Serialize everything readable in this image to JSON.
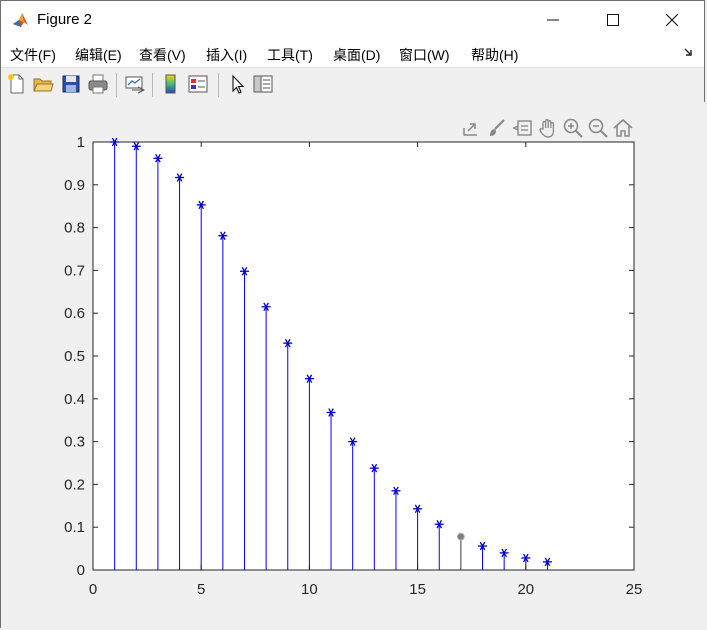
{
  "window": {
    "title": "Figure 2"
  },
  "menu": {
    "items": [
      "文件(F)",
      "编辑(E)",
      "查看(V)",
      "插入(I)",
      "工具(T)",
      "桌面(D)",
      "窗口(W)",
      "帮助(H)"
    ],
    "overflow_icon": "corner-arrow-icon"
  },
  "toolbar": {
    "buttons": [
      "new-figure-icon",
      "open-file-icon",
      "save-icon",
      "print-icon",
      "link-plot-icon",
      "insert-colorbar-icon",
      "insert-legend-icon",
      "edit-plot-icon",
      "open-property-inspector-icon"
    ]
  },
  "axes_toolbar": {
    "buttons": [
      "export-icon",
      "brush-icon",
      "datatip-icon",
      "pan-icon",
      "zoom-in-icon",
      "zoom-out-icon",
      "home-icon"
    ]
  },
  "colors": {
    "stem": "#0000ff",
    "marker": "#0000cd",
    "highlight_marker": "#7f7f7f"
  },
  "chart_data": {
    "type": "stem",
    "x": [
      1,
      2,
      3,
      4,
      5,
      6,
      7,
      8,
      9,
      10,
      11,
      12,
      13,
      14,
      15,
      16,
      17,
      18,
      19,
      20,
      21
    ],
    "y": [
      1.0,
      0.99,
      0.962,
      0.917,
      0.853,
      0.781,
      0.698,
      0.615,
      0.53,
      0.447,
      0.368,
      0.3,
      0.238,
      0.185,
      0.143,
      0.107,
      0.078,
      0.056,
      0.04,
      0.028,
      0.019
    ],
    "marker": "*",
    "highlighted_index": 16,
    "xlim": [
      0,
      25
    ],
    "ylim": [
      0,
      1
    ],
    "xticks": [
      "0",
      "5",
      "10",
      "15",
      "20",
      "25"
    ],
    "yticks": [
      "0",
      "0.1",
      "0.2",
      "0.3",
      "0.4",
      "0.5",
      "0.6",
      "0.7",
      "0.8",
      "0.9",
      "1"
    ],
    "grid": false
  }
}
